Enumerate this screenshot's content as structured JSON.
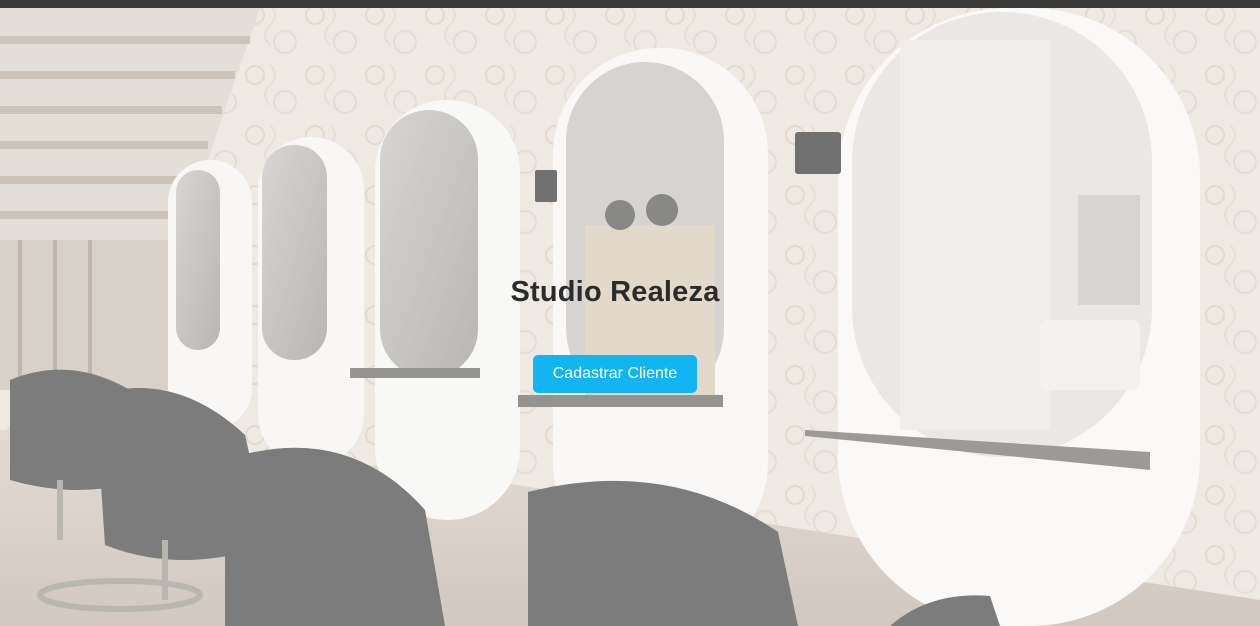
{
  "hero": {
    "title": "Studio Realeza",
    "cta_label": "Cadastrar Cliente"
  },
  "colors": {
    "accent": "#12b5ef",
    "title_text": "#2b2b2b",
    "top_bar": "#3a3a3a"
  }
}
